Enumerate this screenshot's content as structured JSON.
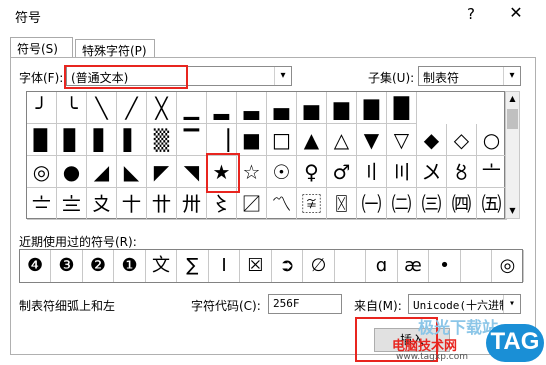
{
  "title": "符号",
  "help": "?",
  "close": "✕",
  "tabs": [
    {
      "label": "符号(S)"
    },
    {
      "label": "特殊字符(P)"
    }
  ],
  "font": {
    "label": "字体(F):",
    "value": "(普通文本)"
  },
  "subset": {
    "label": "子集(U):",
    "value": "制表符"
  },
  "symbols": [
    [
      "╯",
      "╰",
      "╲",
      "╱",
      "╳",
      "▁",
      "▂",
      "▃",
      "▄",
      "▅",
      "▆",
      "▇",
      "█"
    ],
    [
      "▉",
      "▊",
      "▋",
      "▌",
      "▒",
      "▔",
      "▕",
      "■",
      "□",
      "▲",
      "△",
      "▼",
      "▽",
      "◆",
      "◇",
      "○"
    ],
    [
      "◎",
      "●",
      "◢",
      "◣",
      "◤",
      "◥",
      "★",
      "☆",
      "☉",
      "♀",
      "♂",
      "〢",
      "〣",
      "〤",
      "〥",
      "〦"
    ],
    [
      "〧",
      "〨",
      "〩",
      "〸",
      "〹",
      "〺",
      "〻",
      "〼",
      "〽",
      "〾",
      "〿",
      "㈠",
      "㈡",
      "㈢",
      "㈣",
      "㈤"
    ]
  ],
  "recent": {
    "label": "近期使用过的符号(R):",
    "items": [
      "❹",
      "❸",
      "❷",
      "❶",
      "文",
      "∑",
      "Ⅰ",
      "☒",
      "➲",
      "∅",
      "",
      "ɑ",
      "æ",
      "•",
      "",
      "◎"
    ]
  },
  "description": "制表符细弧上和左",
  "char_code": {
    "label": "字符代码(C):",
    "value": "256F"
  },
  "from": {
    "label": "来自(M):",
    "value": "Unicode(十六进制"
  },
  "insert_button": "插入",
  "watermark": {
    "site1": "极光下载站",
    "site2": "电脑技术网",
    "url": "www.tagxp.com",
    "tag": "TAG"
  }
}
